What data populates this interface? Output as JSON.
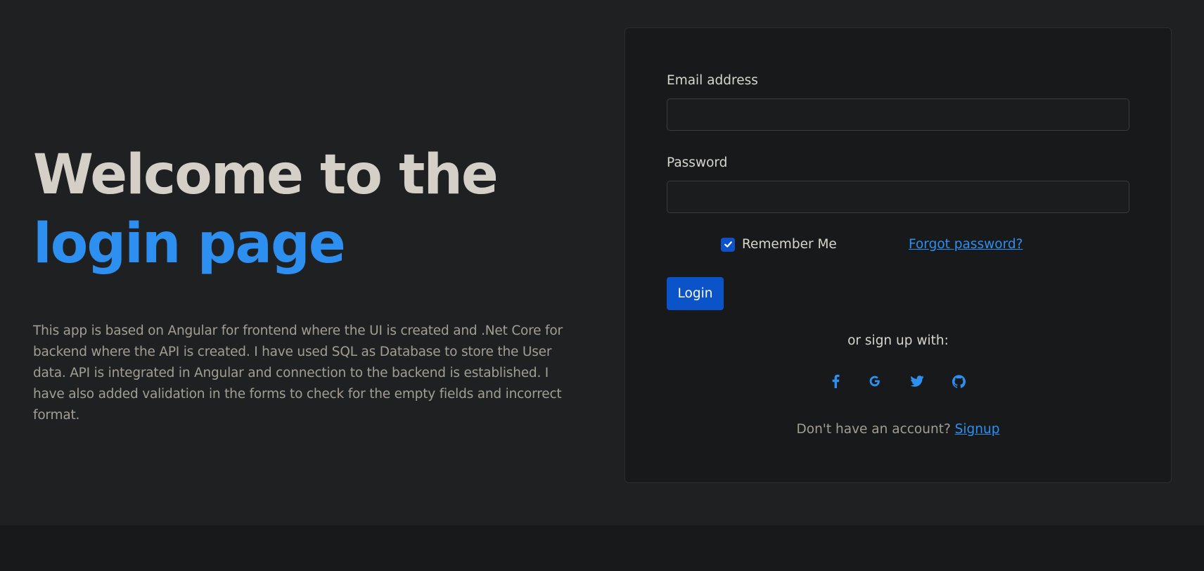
{
  "hero": {
    "title_line1": "Welcome to the",
    "title_line2": "login page",
    "description": "This app is based on Angular for frontend where the UI is created and .Net Core for backend where the API is created. I have used SQL as Database to store the User data. API is integrated in Angular and connection to the backend is established. I have also added validation in the forms to check for the empty fields and incorrect format."
  },
  "form": {
    "email_label": "Email address",
    "email_value": "",
    "password_label": "Password",
    "password_value": "",
    "remember_label": "Remember Me",
    "remember_checked": true,
    "forgot_label": "Forgot password?",
    "login_label": "Login",
    "or_text": "or sign up with:",
    "social_icons": [
      "facebook-icon",
      "google-icon",
      "twitter-icon",
      "github-icon"
    ],
    "signup_prompt": "Don't have an account?",
    "signup_label": "Signup"
  },
  "colors": {
    "accent": "#2d8ff0",
    "button": "#0b53c8",
    "background": "#1f2022",
    "card": "#18191b"
  }
}
